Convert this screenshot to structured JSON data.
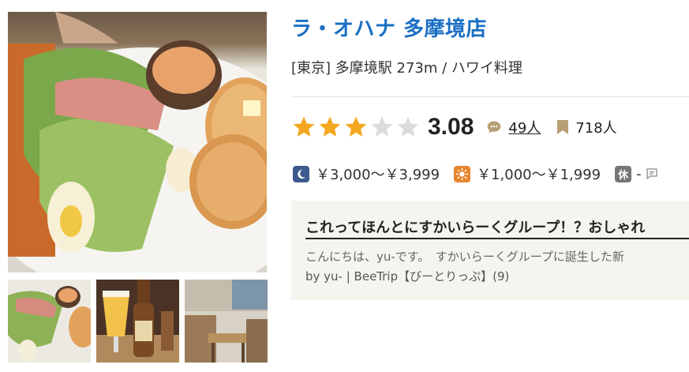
{
  "restaurant": {
    "name": "ラ・オハナ 多摩境店",
    "subtitle": "[東京] 多摩境駅 273m / ハワイ料理"
  },
  "rating": {
    "score": "3.08",
    "stars_filled": 3,
    "stars_total": 5,
    "review_count": "49人",
    "bookmark_count": "718人"
  },
  "price": {
    "dinner": "￥3,000～￥3,999",
    "lunch": "￥1,000～￥1,999",
    "closed_label": "休",
    "closed_value": "-"
  },
  "review": {
    "title": "これってほんとにすかいらーくグループ！？おしゃれ",
    "excerpt": "こんにちは、yu-です。　すかいらーくグループに誕生した新",
    "author": "by yu- | BeeTrip【びーとりっぷ】(9)"
  },
  "colors": {
    "title": "#1a6fc4",
    "star_filled": "#f3a81f",
    "star_empty": "#dcdcdc",
    "dinner_icon": "#3c5a8d",
    "lunch_icon": "#e7852d",
    "review_box_bg": "#f6f4ef"
  },
  "icons": {
    "review": "speech-bubble-icon",
    "bookmark": "bookmark-icon",
    "dinner": "moon-icon",
    "lunch": "sun-icon",
    "comment": "comment-icon"
  }
}
